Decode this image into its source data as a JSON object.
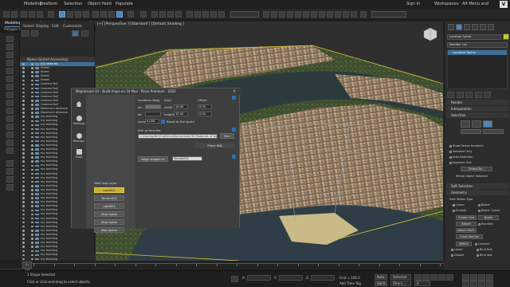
{
  "menubar": {
    "items": [
      "Modeling",
      "Freeform",
      "Selection",
      "Object Paint",
      "Populate"
    ],
    "right_items": [
      "Sign In",
      "Workspaces:",
      "Alt Menu and Toolbar"
    ]
  },
  "toolbar": {
    "view_dropdown": "",
    "selection_set": ""
  },
  "ribbon": {
    "tabs": [
      "Modeling",
      "Freeform",
      "Selection",
      "Object Paint",
      "Populate"
    ],
    "active_tab": "Modeling",
    "sub_label": "Polygon Modeling"
  },
  "explorer": {
    "menu": [
      "Select",
      "Display",
      "Edit",
      "Customize"
    ],
    "header": "Name (Sorted Ascending)",
    "rows": [
      {
        "name": "[0] (default)",
        "selected": true
      },
      {
        "name": "Street",
        "selected": false
      },
      {
        "name": "Street",
        "selected": false
      },
      {
        "name": "Street",
        "selected": false
      },
      {
        "name": "Street",
        "selected": false
      },
      {
        "name": "Camera Null",
        "selected": false
      },
      {
        "name": "Camera Null",
        "selected": false
      },
      {
        "name": "Camera Null",
        "selected": false
      },
      {
        "name": "Camera Null",
        "selected": false
      },
      {
        "name": "Camera Null",
        "selected": false
      },
      {
        "name": "Camera Null",
        "selected": false
      },
      {
        "name": "Maximum distance",
        "selected": false
      },
      {
        "name": "Maximum distance",
        "selected": false
      },
      {
        "name": "my building",
        "selected": false
      },
      {
        "name": "my building",
        "selected": false
      },
      {
        "name": "my building",
        "selected": false
      },
      {
        "name": "my building",
        "selected": false
      },
      {
        "name": "my building",
        "selected": false
      },
      {
        "name": "my building",
        "selected": false
      },
      {
        "name": "my building",
        "selected": false
      },
      {
        "name": "my building",
        "selected": false
      },
      {
        "name": "my building",
        "selected": false
      },
      {
        "name": "my building",
        "selected": false
      },
      {
        "name": "my building",
        "selected": false
      },
      {
        "name": "my building",
        "selected": false
      },
      {
        "name": "my building",
        "selected": false
      },
      {
        "name": "my building",
        "selected": false
      },
      {
        "name": "my building",
        "selected": false
      },
      {
        "name": "my building",
        "selected": false
      },
      {
        "name": "my building",
        "selected": false
      },
      {
        "name": "my building",
        "selected": false
      },
      {
        "name": "my building",
        "selected": false
      },
      {
        "name": "my building",
        "selected": false
      },
      {
        "name": "my building",
        "selected": false
      },
      {
        "name": "my building",
        "selected": false
      },
      {
        "name": "my building",
        "selected": false
      },
      {
        "name": "my building",
        "selected": false
      },
      {
        "name": "my building",
        "selected": false
      },
      {
        "name": "my building",
        "selected": false
      },
      {
        "name": "my building",
        "selected": false
      },
      {
        "name": "my building",
        "selected": false
      },
      {
        "name": "my building",
        "selected": false
      },
      {
        "name": "my building",
        "selected": false
      },
      {
        "name": "my building",
        "selected": false
      },
      {
        "name": "my building",
        "selected": false
      },
      {
        "name": "my building",
        "selected": false
      },
      {
        "name": "my building",
        "selected": false
      },
      {
        "name": "my building",
        "selected": false
      },
      {
        "name": "my building",
        "selected": false
      },
      {
        "name": "my building",
        "selected": false
      },
      {
        "name": "my building",
        "selected": false
      }
    ],
    "footer": "Default"
  },
  "viewport": {
    "label": "[+] [Perspective ] [Standard ] [Default Shading ]"
  },
  "dialog": {
    "title": "Magnesium 01 - Build maps on 3d Max - Place Premium - 2022",
    "close": "×",
    "side": [
      {
        "label": "",
        "icon": "home-icon"
      },
      {
        "label": "Settings",
        "icon": "gear-icon"
      },
      {
        "label": "Release",
        "icon": "globe-icon"
      },
      {
        "label": "Shop",
        "icon": "shop-icon"
      }
    ],
    "location_label": "Location (deg)",
    "area_label": "Area",
    "offset_label": "Offset",
    "lon_label": "lon",
    "lat_label": "lat",
    "width_label": "width",
    "height_label": "height",
    "zoom_label": "zoom",
    "lon_value": "",
    "lat_value": "",
    "width_value": "10.00",
    "height_value": "10.00",
    "offset_x": "0.00",
    "offset_y": "0.00",
    "zoom_value": "0.000",
    "reset_label": "Reset to the world",
    "kml_label": "Kml or Kmz file",
    "kml_path": "C:\\Users\\pfer\\OneDrive\\Documents\\3D Madanes of Architec",
    "run_label": "Run",
    "place_kml": "Place KML",
    "align_label": "Align shapes to",
    "align_value": "Terrain001",
    "layers_title": "New map layer",
    "layers": [
      {
        "label": "road001",
        "active": true
      },
      {
        "label": "Terrain001",
        "active": false
      },
      {
        "label": "road001",
        "active": false
      },
      {
        "label": "Map roads",
        "active": false
      },
      {
        "label": "Map roads",
        "active": false
      },
      {
        "label": "Map space",
        "active": false
      }
    ]
  },
  "cmdpanel": {
    "object_name": "Location Spline",
    "modifier_list": "Modifier List",
    "stack_item": "Location Spline",
    "rollouts": [
      "Render",
      "Interpolation",
      "Selection",
      "Soft Selection",
      "Geometry"
    ],
    "selection_buttons": [
      "",
      "",
      ""
    ],
    "show_vertex_numbers": "Show Vertex Numbers",
    "selected_only": "Selected Only",
    "area_selection": "Area Selection",
    "segment_end": "Segment End",
    "select_by": "Select By...",
    "whole_selected": "Whole Object Selected",
    "new_vertex_type": "New Vertex Type",
    "vtypes": [
      "Linear",
      "Bezier",
      "Smooth",
      "Bezier Corner"
    ],
    "create_line": "Create Line",
    "break": "Break",
    "attach": "Attach",
    "reorient": "Reorient",
    "attach_mult": "Attach Mult.",
    "cross_section": "Cross Section",
    "refine": "Refine",
    "connect": "Connect",
    "linear": "Linear",
    "bind_first": "Bind first",
    "closed": "Closed",
    "bind_last": "Bind last"
  },
  "status": {
    "shape_selected": "1 Shape Selected",
    "click_hint": "Click or click-and-drag to select objects",
    "x_label": "X:",
    "y_label": "Y:",
    "z_label": "Z:",
    "grid": "Grid = 100.0",
    "add_time_tag": "Add Time Tag",
    "auto": "Auto",
    "selected": "Selected",
    "set_k": "Set K.",
    "filters": "Filters...",
    "frame": "0",
    "x_value": "",
    "y_value": "",
    "z_value": "",
    "frame_counter": "0 / 100"
  }
}
